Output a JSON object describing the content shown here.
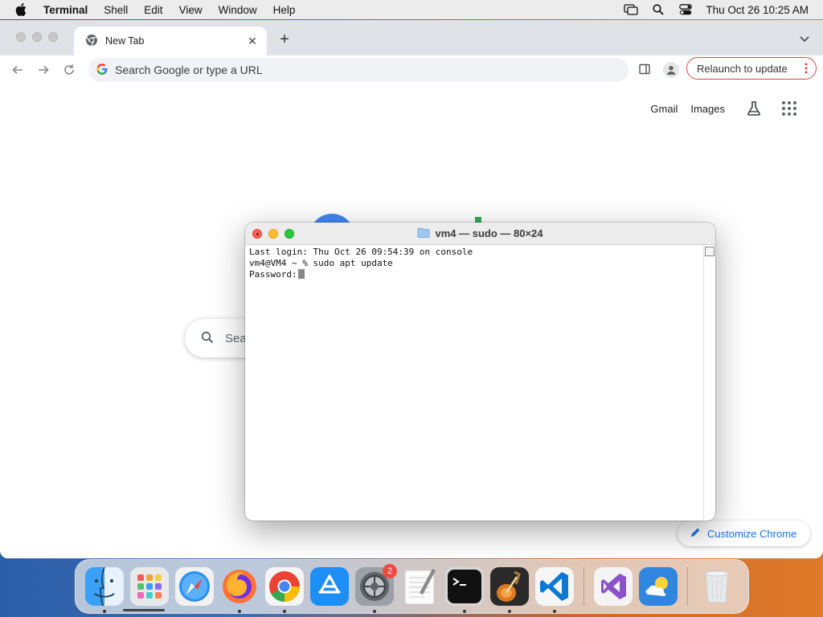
{
  "menubar": {
    "app_name": "Terminal",
    "menus": [
      "Shell",
      "Edit",
      "View",
      "Window",
      "Help"
    ],
    "clock": "Thu Oct 26  10:25 AM"
  },
  "browser": {
    "tab_title": "New Tab",
    "omnibox_placeholder": "Search Google or type a URL",
    "relaunch_label": "Relaunch to update",
    "relaunch_border_color": "#d14a45"
  },
  "ntp": {
    "links": [
      "Gmail",
      "Images"
    ],
    "search_placeholder_visible": "Sea",
    "customize_label": "Customize Chrome",
    "accent": "#1a73e8"
  },
  "terminal": {
    "title": "vm4 — sudo — 80×24",
    "lines": [
      "Last login: Thu Oct 26 09:54:39 on console",
      "vm4@VM4 ~ % sudo apt update",
      "Password:"
    ]
  },
  "dock": {
    "items": [
      {
        "name": "Finder",
        "icon": "finder-icon",
        "running": true
      },
      {
        "name": "Launchpad",
        "icon": "launchpad-icon",
        "running": false
      },
      {
        "name": "Safari",
        "icon": "safari-icon",
        "running": false
      },
      {
        "name": "Firefox",
        "icon": "firefox-icon",
        "running": true
      },
      {
        "name": "Google Chrome",
        "icon": "chrome-icon",
        "running": true
      },
      {
        "name": "App Store",
        "icon": "app-store-icon",
        "running": false
      },
      {
        "name": "System Settings",
        "icon": "system-settings-icon",
        "running": true,
        "badge": "2"
      },
      {
        "name": "TextEdit",
        "icon": "textedit-icon",
        "running": false
      },
      {
        "name": "Terminal",
        "icon": "terminal-icon",
        "running": true
      },
      {
        "name": "GarageBand",
        "icon": "garageband-icon",
        "running": true
      },
      {
        "name": "Visual Studio Code",
        "icon": "vscode-icon",
        "running": true
      },
      {
        "name": "Visual Studio",
        "icon": "visual-studio-icon",
        "running": false
      },
      {
        "name": "Weather",
        "icon": "weather-icon",
        "running": false
      },
      {
        "name": "Trash",
        "icon": "trash-icon",
        "running": false
      }
    ]
  }
}
